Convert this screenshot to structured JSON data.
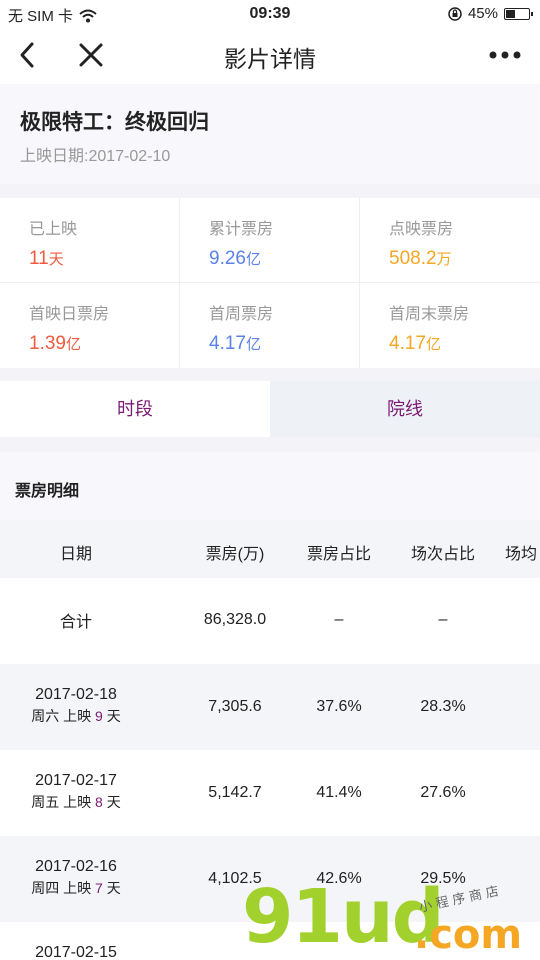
{
  "status": {
    "carrier": "无 SIM 卡",
    "time": "09:39",
    "battery": "45%",
    "battery_level": 0.45
  },
  "nav": {
    "title": "影片详情"
  },
  "movie": {
    "title": "极限特工：终极回归",
    "release": "上映日期:2017-02-10"
  },
  "stats": [
    {
      "label": "已上映",
      "value": "11",
      "unit": "天",
      "color": "#ef5b41"
    },
    {
      "label": "累计票房",
      "value": "9.26",
      "unit": "亿",
      "color": "#5a82e8"
    },
    {
      "label": "点映票房",
      "value": "508.2",
      "unit": "万",
      "color": "#f5a623"
    },
    {
      "label": "首映日票房",
      "value": "1.39",
      "unit": "亿",
      "color": "#ef5b41"
    },
    {
      "label": "首周票房",
      "value": "4.17",
      "unit": "亿",
      "color": "#5a82e8"
    },
    {
      "label": "首周末票房",
      "value": "4.17",
      "unit": "亿",
      "color": "#f5a623"
    }
  ],
  "tabs": [
    {
      "label": "时段",
      "active": true
    },
    {
      "label": "院线",
      "active": false
    }
  ],
  "section": {
    "title": "票房明细"
  },
  "table": {
    "headers": [
      "日期",
      "票房(万)",
      "票房占比",
      "场次占比",
      "场均"
    ],
    "total": {
      "label": "合计",
      "box": "86,328.0",
      "share": "–",
      "screen": "–"
    },
    "rows": [
      {
        "date": "2017-02-18",
        "weekday": "周六",
        "prefix": "上映",
        "day": "9",
        "suffix": "天",
        "box": "7,305.6",
        "share": "37.6%",
        "screen": "28.3%"
      },
      {
        "date": "2017-02-17",
        "weekday": "周五",
        "prefix": "上映",
        "day": "8",
        "suffix": "天",
        "box": "5,142.7",
        "share": "41.4%",
        "screen": "27.6%"
      },
      {
        "date": "2017-02-16",
        "weekday": "周四",
        "prefix": "上映",
        "day": "7",
        "suffix": "天",
        "box": "4,102.5",
        "share": "42.6%",
        "screen": "29.5%"
      },
      {
        "date": "2017-02-15",
        "weekday": "",
        "prefix": "",
        "day": "",
        "suffix": "",
        "box": "",
        "share": "",
        "screen": ""
      }
    ]
  },
  "watermark": {
    "big": "91ud",
    "com": ".com",
    "small": "小程序商店"
  }
}
